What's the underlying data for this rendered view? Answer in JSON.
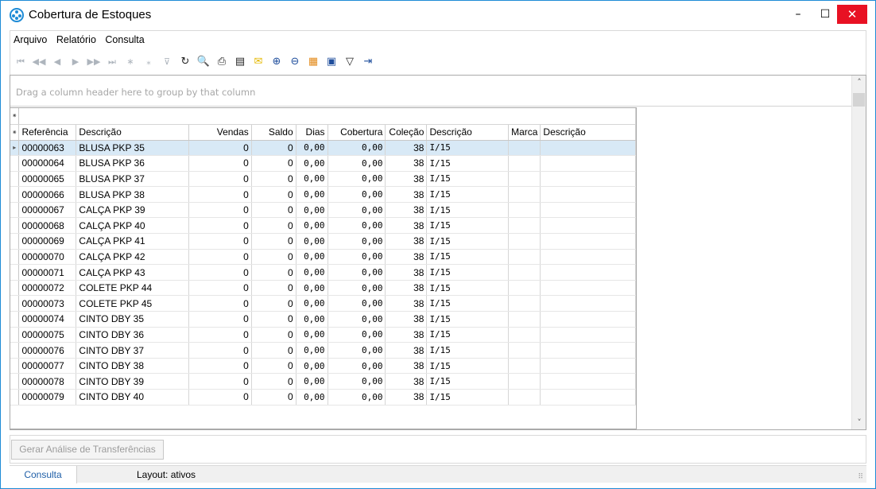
{
  "window": {
    "title": "Cobertura de Estoques",
    "min_icon": "minimize-icon",
    "max_icon": "maximize-icon",
    "close_icon": "close-icon",
    "min_glyph": "–",
    "max_glyph": "☐",
    "close_glyph": "✕"
  },
  "menu": {
    "items": [
      "Arquivo",
      "Relatório",
      "Consulta"
    ]
  },
  "toolbar": {
    "nav": [
      {
        "name": "first-page-icon",
        "glyph": "⏮"
      },
      {
        "name": "prev-page-icon",
        "glyph": "◀◀"
      },
      {
        "name": "prev-icon",
        "glyph": "◀"
      },
      {
        "name": "next-icon",
        "glyph": "▶"
      },
      {
        "name": "next-page-icon",
        "glyph": "▶▶"
      },
      {
        "name": "last-page-icon",
        "glyph": "⏭"
      },
      {
        "name": "insert-icon",
        "glyph": "∗"
      },
      {
        "name": "insert-copy-icon",
        "glyph": "⁎"
      },
      {
        "name": "filter-row-icon",
        "glyph": "⊽"
      }
    ],
    "actions": [
      {
        "name": "refresh-icon",
        "glyph": "↻"
      },
      {
        "name": "print-preview-icon",
        "glyph": "🔍"
      },
      {
        "name": "print-icon",
        "glyph": "⎙"
      },
      {
        "name": "export-icon",
        "glyph": "▤"
      },
      {
        "name": "email-icon",
        "glyph": "✉"
      },
      {
        "name": "zoom-in-icon",
        "glyph": "⊕"
      },
      {
        "name": "zoom-out-icon",
        "glyph": "⊖"
      },
      {
        "name": "layout-icon",
        "glyph": "▦"
      },
      {
        "name": "save-layout-icon",
        "glyph": "▣"
      },
      {
        "name": "filter-icon",
        "glyph": "▽"
      },
      {
        "name": "exit-icon",
        "glyph": "⇥"
      }
    ]
  },
  "grid": {
    "group_hint": "Drag a column header here to group by that column",
    "filter_marker": "⁕",
    "selected_marker": "▸",
    "columns": [
      "Referência",
      "Descrição",
      "Vendas",
      "Saldo",
      "Dias",
      "Cobertura",
      "Coleção",
      "Descrição",
      "Marca",
      "Descrição"
    ],
    "rows": [
      [
        "00000063",
        "BLUSA PKP 35",
        "0",
        "0",
        "0,00",
        "0,00",
        "38",
        "I/15",
        "",
        ""
      ],
      [
        "00000064",
        "BLUSA PKP 36",
        "0",
        "0",
        "0,00",
        "0,00",
        "38",
        "I/15",
        "",
        ""
      ],
      [
        "00000065",
        "BLUSA PKP 37",
        "0",
        "0",
        "0,00",
        "0,00",
        "38",
        "I/15",
        "",
        ""
      ],
      [
        "00000066",
        "BLUSA PKP 38",
        "0",
        "0",
        "0,00",
        "0,00",
        "38",
        "I/15",
        "",
        ""
      ],
      [
        "00000067",
        "CALÇA PKP 39",
        "0",
        "0",
        "0,00",
        "0,00",
        "38",
        "I/15",
        "",
        ""
      ],
      [
        "00000068",
        "CALÇA PKP 40",
        "0",
        "0",
        "0,00",
        "0,00",
        "38",
        "I/15",
        "",
        ""
      ],
      [
        "00000069",
        "CALÇA PKP 41",
        "0",
        "0",
        "0,00",
        "0,00",
        "38",
        "I/15",
        "",
        ""
      ],
      [
        "00000070",
        "CALÇA PKP 42",
        "0",
        "0",
        "0,00",
        "0,00",
        "38",
        "I/15",
        "",
        ""
      ],
      [
        "00000071",
        "CALÇA PKP 43",
        "0",
        "0",
        "0,00",
        "0,00",
        "38",
        "I/15",
        "",
        ""
      ],
      [
        "00000072",
        "COLETE PKP 44",
        "0",
        "0",
        "0,00",
        "0,00",
        "38",
        "I/15",
        "",
        ""
      ],
      [
        "00000073",
        "COLETE PKP 45",
        "0",
        "0",
        "0,00",
        "0,00",
        "38",
        "I/15",
        "",
        ""
      ],
      [
        "00000074",
        "CINTO DBY 35",
        "0",
        "0",
        "0,00",
        "0,00",
        "38",
        "I/15",
        "",
        ""
      ],
      [
        "00000075",
        "CINTO DBY 36",
        "0",
        "0",
        "0,00",
        "0,00",
        "38",
        "I/15",
        "",
        ""
      ],
      [
        "00000076",
        "CINTO DBY 37",
        "0",
        "0",
        "0,00",
        "0,00",
        "38",
        "I/15",
        "",
        ""
      ],
      [
        "00000077",
        "CINTO DBY 38",
        "0",
        "0",
        "0,00",
        "0,00",
        "38",
        "I/15",
        "",
        ""
      ],
      [
        "00000078",
        "CINTO DBY 39",
        "0",
        "0",
        "0,00",
        "0,00",
        "38",
        "I/15",
        "",
        ""
      ],
      [
        "00000079",
        "CINTO DBY 40",
        "0",
        "0",
        "0,00",
        "0,00",
        "38",
        "I/15",
        "",
        ""
      ]
    ],
    "selected_row_color": "#d8e9f6"
  },
  "scrollbar": {
    "up": "˄",
    "down": "˅"
  },
  "actions": {
    "gerar_label": "Gerar Análise de Transferências"
  },
  "status": {
    "tab_label": "Consulta",
    "layout_text": "Layout: ativos",
    "grip": "⠿"
  },
  "colors": {
    "accent": "#1e8bd6",
    "close": "#e81123"
  }
}
